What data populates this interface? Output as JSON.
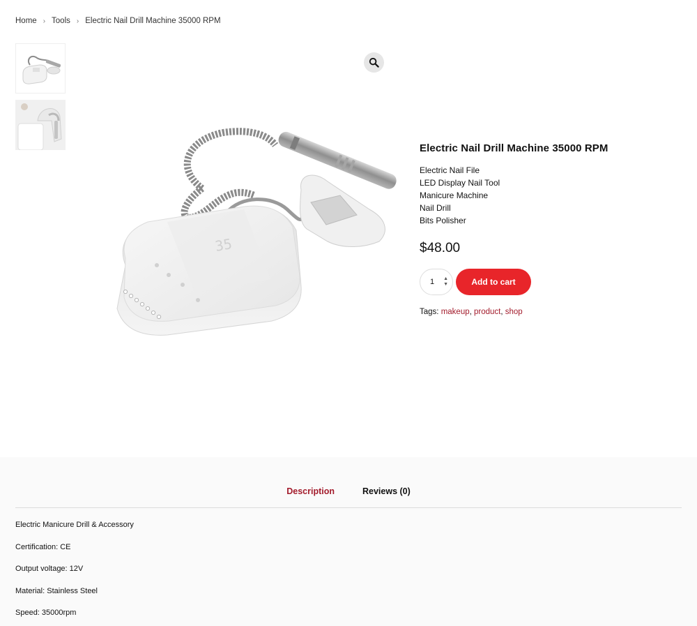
{
  "breadcrumb": {
    "items": [
      "Home",
      "Tools",
      "Electric Nail Drill Machine 35000 RPM"
    ],
    "separator": "›"
  },
  "gallery": {
    "thumbnails": [
      "nail-drill-thumb",
      "nail-drill-alt-thumb"
    ],
    "zoom_icon": "magnifier-icon"
  },
  "product": {
    "title": "Electric Nail Drill Machine 35000 RPM",
    "features": [
      "Electric Nail File",
      "LED Display Nail Tool",
      "Manicure Machine",
      "Nail Drill",
      "Bits Polisher"
    ],
    "price": "$48.00",
    "quantity": "1",
    "add_to_cart_label": "Add to cart",
    "tags_label": "Tags:",
    "tags": [
      "makeup",
      "product",
      "shop"
    ]
  },
  "tabs": {
    "items": [
      "Description",
      "Reviews (0)"
    ],
    "active": "Description"
  },
  "description": {
    "lines": [
      "Electric Manicure Drill & Accessory",
      "Certification: CE",
      "Output voltage: 12V",
      "Material: Stainless Steel",
      "Speed: 35000rpm"
    ]
  },
  "colors": {
    "accent_button": "#e8252a",
    "link": "#a31c2c",
    "tab_bg": "#fafafa"
  }
}
